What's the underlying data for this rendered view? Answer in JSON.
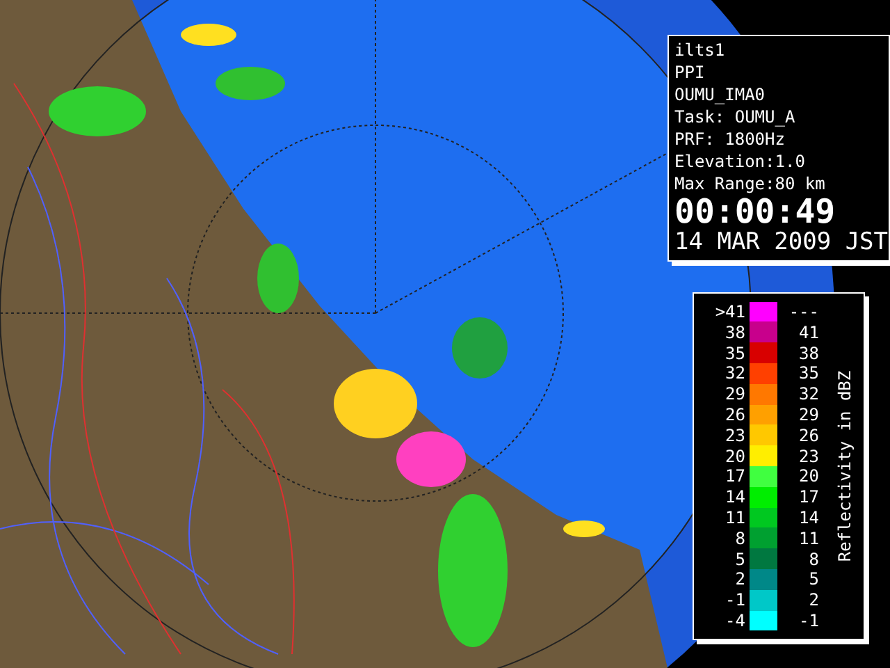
{
  "radar_info": {
    "lines": [
      "ilts1",
      "PPI",
      "OUMU_IMA0",
      "Task: OUMU_A",
      "PRF: 1800Hz",
      "Elevation:1.0",
      "Max Range:80 km"
    ],
    "time": "00:00:49",
    "date": "14 MAR 2009 JST"
  },
  "legend": {
    "title": "Reflectivity in dBZ",
    "rows": [
      {
        "low": ">41",
        "high": "---",
        "color": "#ff00ff"
      },
      {
        "low": "38",
        "high": "41",
        "color": "#c8008c"
      },
      {
        "low": "35",
        "high": "38",
        "color": "#d80000"
      },
      {
        "low": "32",
        "high": "35",
        "color": "#ff4000"
      },
      {
        "low": "29",
        "high": "32",
        "color": "#ff7800"
      },
      {
        "low": "26",
        "high": "29",
        "color": "#ffa000"
      },
      {
        "low": "23",
        "high": "26",
        "color": "#ffc800"
      },
      {
        "low": "20",
        "high": "23",
        "color": "#ffee00"
      },
      {
        "low": "17",
        "high": "20",
        "color": "#40ff40"
      },
      {
        "low": "14",
        "high": "17",
        "color": "#00ee00"
      },
      {
        "low": "11",
        "high": "14",
        "color": "#00c820"
      },
      {
        "low": "8",
        "high": "11",
        "color": "#00a030"
      },
      {
        "low": "5",
        "high": "8",
        "color": "#007840"
      },
      {
        "low": "2",
        "high": "5",
        "color": "#008888"
      },
      {
        "low": "-1",
        "high": "2",
        "color": "#00c8c8"
      },
      {
        "low": "-4",
        "high": "-1",
        "color": "#00ffff"
      }
    ]
  }
}
